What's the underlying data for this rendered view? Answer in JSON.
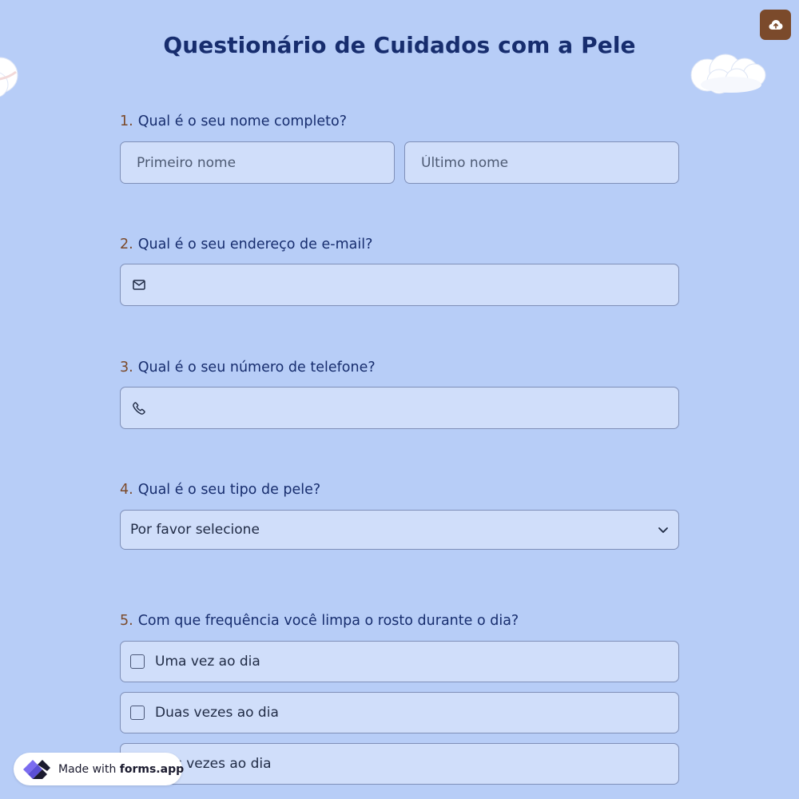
{
  "form": {
    "title": "Questionário de Cuidados com a Pele"
  },
  "questions": [
    {
      "number": "1.",
      "label": "Qual é o seu nome completo?",
      "first_name_placeholder": "Primeiro nome",
      "last_name_placeholder": "Último nome"
    },
    {
      "number": "2.",
      "label": "Qual é o seu endereço de e-mail?",
      "icon": "mail-icon",
      "value": ""
    },
    {
      "number": "3.",
      "label": "Qual é o seu número de telefone?",
      "icon": "phone-icon",
      "value": ""
    },
    {
      "number": "4.",
      "label": "Qual é o seu tipo de pele?",
      "selected": "Por favor selecione",
      "icon": "chevron-down-icon"
    },
    {
      "number": "5.",
      "label": "Com que frequência você limpa o rosto durante o dia?",
      "options": [
        {
          "label": "Uma vez ao dia",
          "checked": false
        },
        {
          "label": "Duas vezes ao dia",
          "checked": false
        },
        {
          "label": "Três vezes ao dia",
          "checked": false
        }
      ]
    }
  ],
  "toolbar": {
    "upload_icon": "cloud-upload-icon"
  },
  "badge": {
    "prefix": "Made with",
    "brand": "forms.app"
  },
  "colors": {
    "background": "#b7cdf7",
    "field_background": "#d0defa",
    "field_border": "#7f8fb8",
    "title": "#172d6e",
    "accent": "#7b4a2b"
  }
}
